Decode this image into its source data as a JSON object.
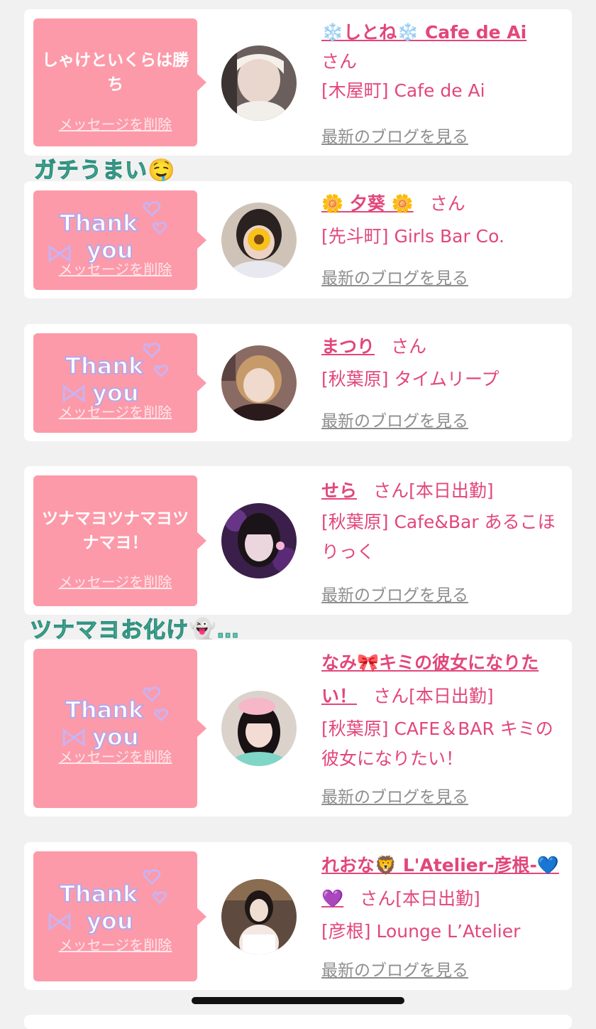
{
  "messages": [
    {
      "message": "しゃけといくらは勝ち",
      "delete_label": "メッセージを削除",
      "name": "❄️しとね❄️ Cafe de Ai",
      "san": "さん",
      "status": "",
      "shop": "[木屋町] Cafe de Ai",
      "blog_label": "最新のブログを見る"
    },
    {
      "message": "",
      "sticker_text": "Thank you",
      "delete_label": "メッセージを削除",
      "name": "🌼 夕葵 🌼",
      "san": "さん",
      "status": "",
      "shop": "[先斗町] Girls Bar Co.",
      "blog_label": "最新のブログを見る"
    },
    {
      "message": "",
      "sticker_text": "Thank you",
      "delete_label": "メッセージを削除",
      "name": "まつり",
      "san": "さん",
      "status": "",
      "shop": "[秋葉原] タイムリープ",
      "blog_label": "最新のブログを見る"
    },
    {
      "message": "ツナマヨツナマヨツナマヨ！",
      "delete_label": "メッセージを削除",
      "name": "せら",
      "san": "さん",
      "status": "[本日出勤]",
      "shop": "[秋葉原] Cafe&Bar あるこほりっく",
      "blog_label": "最新のブログを見る"
    },
    {
      "message": "",
      "sticker_text": "Thank you",
      "delete_label": "メッセージを削除",
      "name": "なみ🎀キミの彼女になりたい！",
      "san": "さん",
      "status": "[本日出勤]",
      "shop": "[秋葉原] CAFE＆BAR キミの彼女になりたい！",
      "blog_label": "最新のブログを見る"
    },
    {
      "message": "",
      "sticker_text": "Thank you",
      "delete_label": "メッセージを削除",
      "name": "れおな🦁 L'Atelier-彦根-💙💜",
      "san": "さん",
      "status": "[本日出勤]",
      "shop": "[彦根] Lounge L’Atelier",
      "blog_label": "最新のブログを見る"
    }
  ],
  "decorations": {
    "deco1": "ガチうまい🤤",
    "deco2": "ツナマヨお化け👻…"
  },
  "colors": {
    "accent": "#e2477a",
    "bubble": "#fc9aa9",
    "link_gray": "#8e8e8e",
    "background": "#f1f1f1"
  }
}
